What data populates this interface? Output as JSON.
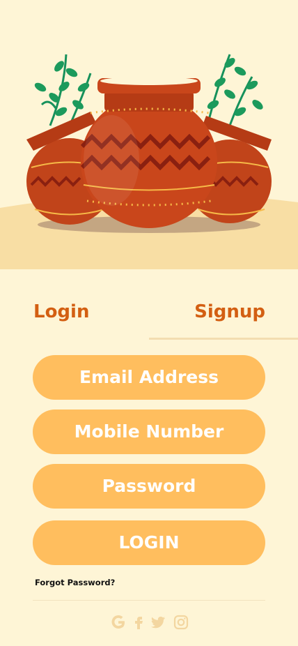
{
  "auth_tabs": {
    "login_label": "Login",
    "signup_label": "Signup"
  },
  "form": {
    "email_label": "Email Address",
    "mobile_label": "Mobile Number",
    "password_label": "Password",
    "submit_label": "LOGIN",
    "forgot_label": "Forgot Password?"
  },
  "social_icons": [
    "google-icon",
    "facebook-icon",
    "twitter-icon",
    "instagram-icon"
  ],
  "colors": {
    "background": "#fef5d6",
    "accent": "#d35f12",
    "field": "#ffbe5e",
    "social": "#f3d6a0"
  }
}
